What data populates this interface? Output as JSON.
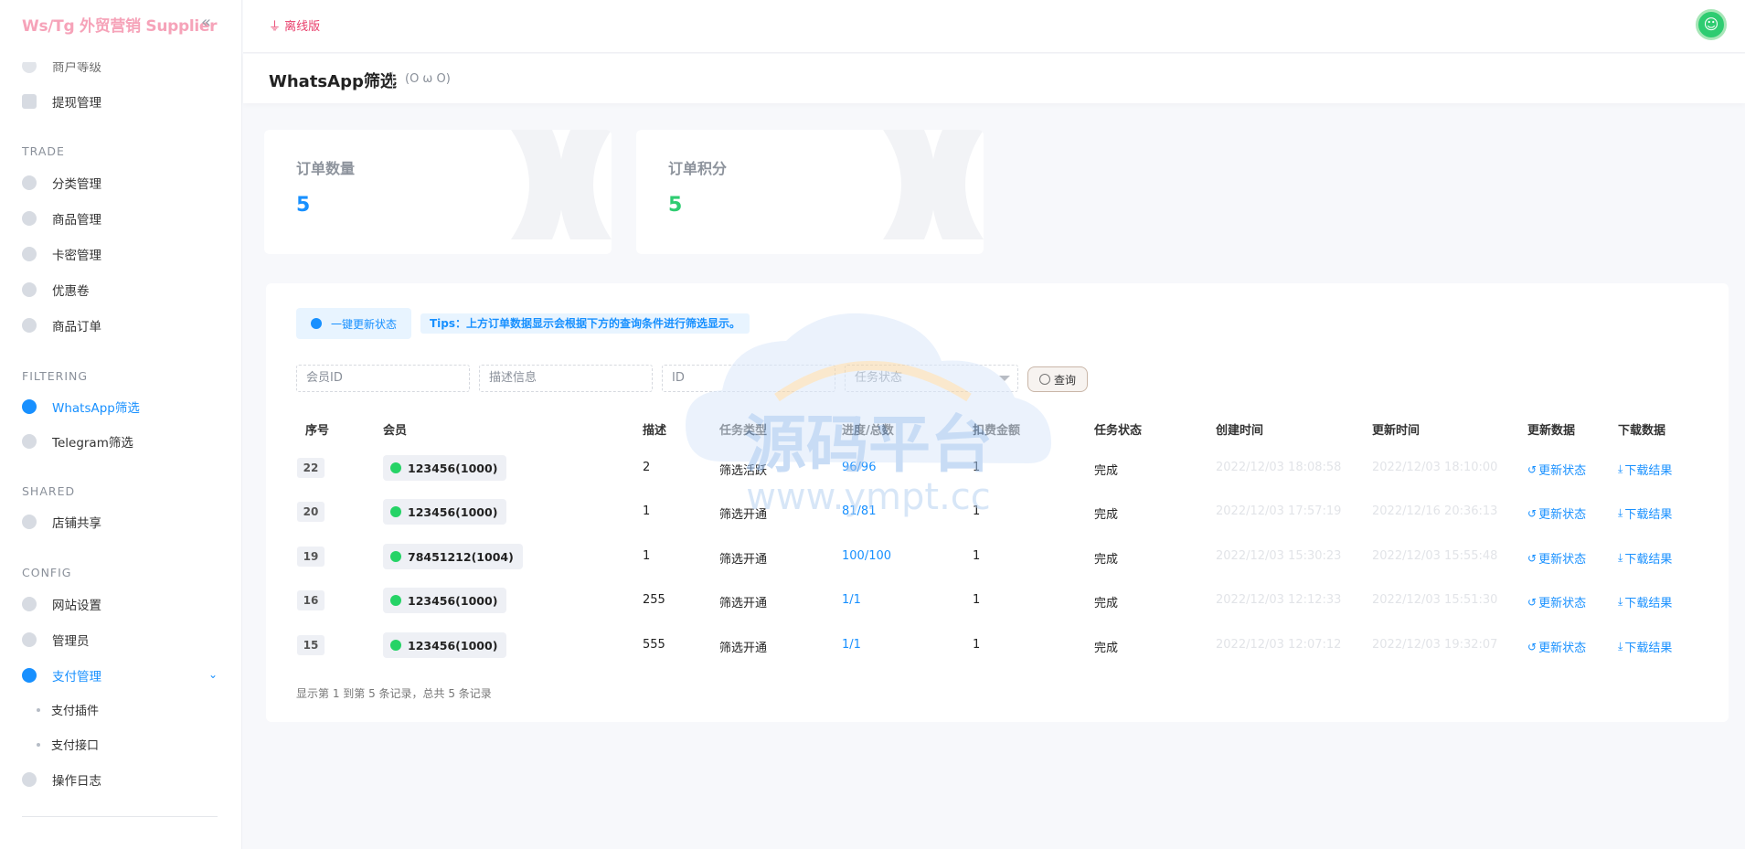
{
  "sidebar": {
    "brand": "Ws/Tg 外贸营销 Supplier",
    "partial_item": "商户等级",
    "items_top": [
      {
        "label": "提现管理"
      }
    ],
    "sections": {
      "trade": "TRADE",
      "filtering": "FILTERING",
      "shared": "SHARED",
      "config": "CONFIG"
    },
    "trade_items": [
      {
        "label": "分类管理"
      },
      {
        "label": "商品管理"
      },
      {
        "label": "卡密管理"
      },
      {
        "label": "优惠卷"
      },
      {
        "label": "商品订单"
      }
    ],
    "filtering_items": [
      {
        "label": "WhatsApp筛选"
      },
      {
        "label": "Telegram筛选"
      }
    ],
    "shared_items": [
      {
        "label": "店铺共享"
      }
    ],
    "config_items": [
      {
        "label": "网站设置"
      },
      {
        "label": "管理员"
      },
      {
        "label": "支付管理"
      }
    ],
    "pay_sub": [
      {
        "label": "支付插件"
      },
      {
        "label": "支付接口"
      }
    ],
    "log_item": "操作日志"
  },
  "topbar": {
    "offline": "离线版"
  },
  "page": {
    "title": "WhatsApp筛选",
    "kaomoji": "(O ω O)"
  },
  "stats": [
    {
      "label": "订单数量",
      "value": "5",
      "color": "#1890ff"
    },
    {
      "label": "订单积分",
      "value": "5",
      "color": "#2ecc71"
    }
  ],
  "toolbar": {
    "refresh_label": "一键更新状态",
    "tips": "Tips：上方订单数据显示会根据下方的查询条件进行筛选显示。",
    "member_placeholder": "会员ID",
    "desc_placeholder": "描述信息",
    "id_placeholder": "ID",
    "status_placeholder": "任务状态",
    "query_label": "查询"
  },
  "table": {
    "headers": {
      "no": "序号",
      "member": "会员",
      "desc": "描述",
      "type": "任务类型",
      "progress": "进度/总数",
      "fee": "扣费金额",
      "status": "任务状态",
      "created": "创建时间",
      "updated": "更新时间",
      "update_data": "更新数据",
      "download_data": "下载数据"
    },
    "update_action": "更新状态",
    "download_action": "下载结果",
    "rows": [
      {
        "no": "22",
        "member": "123456(1000)",
        "desc": "2",
        "type": "筛选活跃",
        "progress": "96/96",
        "fee": "1",
        "status": "完成",
        "created": "2022/12/03 18:08:58",
        "updated": "2022/12/03 18:10:00"
      },
      {
        "no": "20",
        "member": "123456(1000)",
        "desc": "1",
        "type": "筛选开通",
        "progress": "81/81",
        "fee": "1",
        "status": "完成",
        "created": "2022/12/03 17:57:19",
        "updated": "2022/12/16 20:36:13"
      },
      {
        "no": "19",
        "member": "78451212(1004)",
        "desc": "1",
        "type": "筛选开通",
        "progress": "100/100",
        "fee": "1",
        "status": "完成",
        "created": "2022/12/03 15:30:23",
        "updated": "2022/12/03 15:55:48"
      },
      {
        "no": "16",
        "member": "123456(1000)",
        "desc": "255",
        "type": "筛选开通",
        "progress": "1/1",
        "fee": "1",
        "status": "完成",
        "created": "2022/12/03 12:12:33",
        "updated": "2022/12/03 15:51:30"
      },
      {
        "no": "15",
        "member": "123456(1000)",
        "desc": "555",
        "type": "筛选开通",
        "progress": "1/1",
        "fee": "1",
        "status": "完成",
        "created": "2022/12/03 12:07:12",
        "updated": "2022/12/03 19:32:07"
      }
    ],
    "footer": "显示第 1 到第 5 条记录，总共 5 条记录"
  },
  "watermark": {
    "title": "源码平台",
    "url": "www.ympt.cc"
  }
}
